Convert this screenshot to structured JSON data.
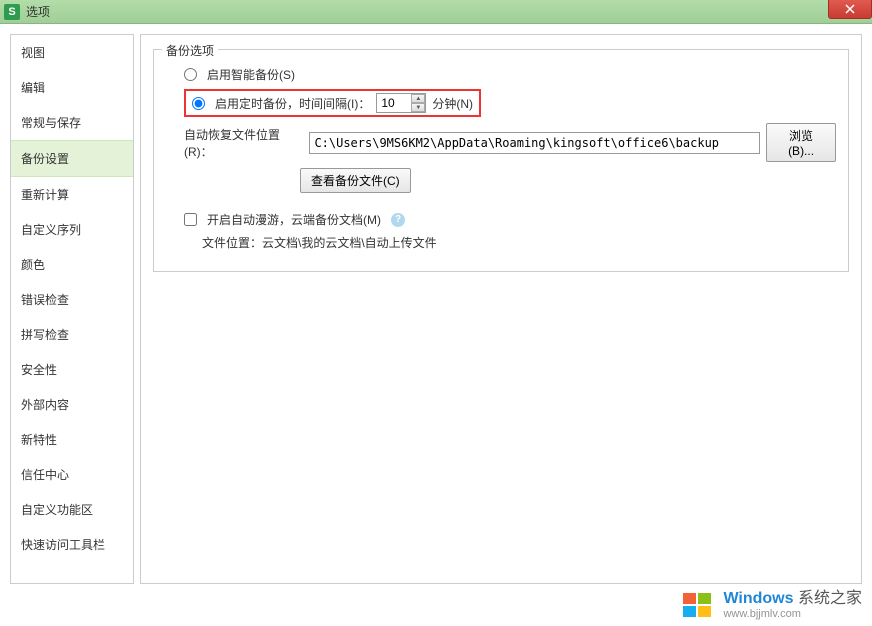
{
  "titlebar": {
    "title": "选项"
  },
  "sidebar": {
    "items": [
      {
        "label": "视图"
      },
      {
        "label": "编辑"
      },
      {
        "label": "常规与保存"
      },
      {
        "label": "备份设置"
      },
      {
        "label": "重新计算"
      },
      {
        "label": "自定义序列"
      },
      {
        "label": "颜色"
      },
      {
        "label": "错误检查"
      },
      {
        "label": "拼写检查"
      },
      {
        "label": "安全性"
      },
      {
        "label": "外部内容"
      },
      {
        "label": "新特性"
      },
      {
        "label": "信任中心"
      },
      {
        "label": "自定义功能区"
      },
      {
        "label": "快速访问工具栏"
      }
    ],
    "selected_index": 3
  },
  "backup": {
    "group_title": "备份选项",
    "smart_backup_label": "启用智能备份(S)",
    "timed_backup_label": "启用定时备份，时间间隔(I)：",
    "interval_value": "10",
    "minutes_label": "分钟(N)",
    "recover_path_label": "自动恢复文件位置(R)：",
    "recover_path_value": "C:\\Users\\9MS6KM2\\AppData\\Roaming\\kingsoft\\office6\\backup",
    "browse_label": "浏览(B)...",
    "view_backup_label": "查看备份文件(C)",
    "roaming_label": "开启自动漫游，云端备份文档(M)",
    "roaming_path_label": "文件位置：云文档\\我的云文档\\自动上传文件"
  },
  "watermark": {
    "brand_main": "Windows",
    "brand_sub": "系统之家",
    "url": "www.bjjmlv.com"
  }
}
